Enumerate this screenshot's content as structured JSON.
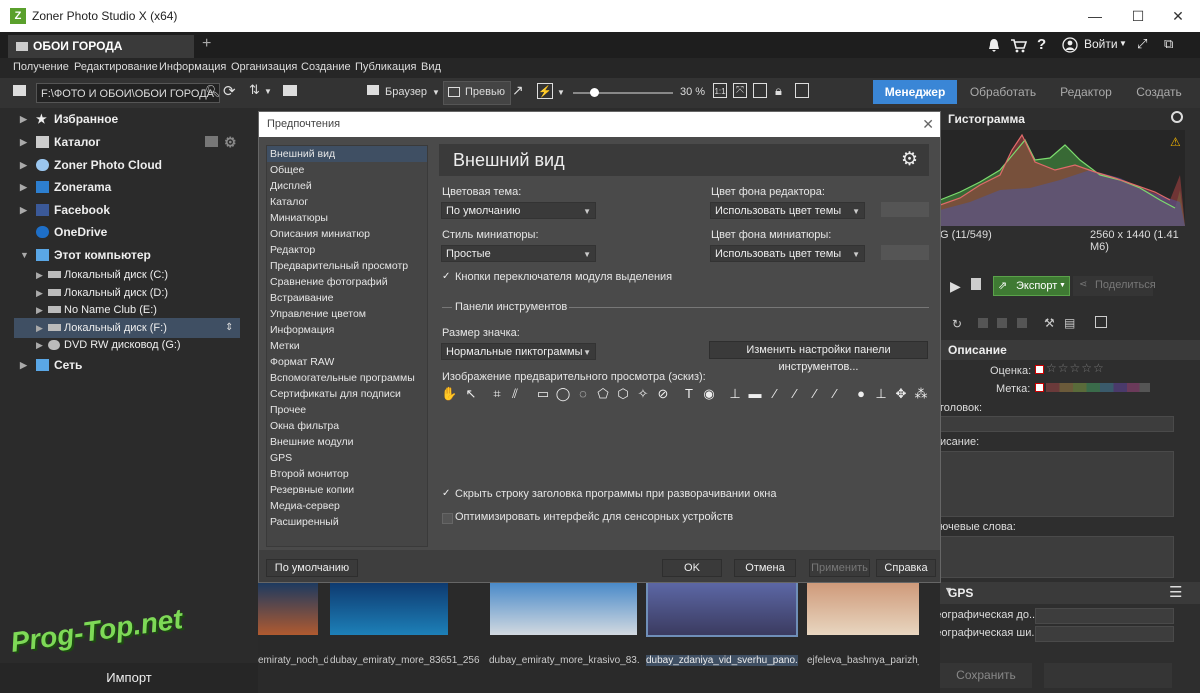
{
  "window": {
    "title": "Zoner Photo Studio X (x64)",
    "minimize": "—",
    "maximize": "☐",
    "close": "✕"
  },
  "tab": {
    "name": "ОБОИ ГОРОДА",
    "add": "+"
  },
  "header_right": {
    "login": "Войти"
  },
  "menu": [
    "Получение",
    "Редактирование",
    "Информация",
    "Организация",
    "Создание",
    "Публикация",
    "Вид"
  ],
  "toolbar": {
    "path": "F:\\ФОТО И ОБОИ\\ОБОИ ГОРОДА",
    "browser": "Браузер",
    "preview": "Превью",
    "zoom": "30 %"
  },
  "modes": {
    "manager": "Менеджер",
    "process": "Обработать",
    "editor": "Редактор",
    "create": "Создать"
  },
  "nav": {
    "favorites": "Избранное",
    "catalog": "Каталог",
    "zoner_cloud": "Zoner Photo Cloud",
    "zonerama": "Zonerama",
    "facebook": "Facebook",
    "onedrive": "OneDrive",
    "this_pc": "Этот компьютер",
    "drives": [
      "Локальный диск (C:)",
      "Локальный диск (D:)",
      "No Name Club (E:)",
      "Локальный диск (F:)",
      "DVD RW дисковод (G:)"
    ],
    "network": "Сеть",
    "import": "Импорт"
  },
  "right": {
    "histogram": "Гистограмма",
    "counter": "G  (11/549)",
    "resolution": "2560 x 1440 (1.41 M6)",
    "export": "Экспорт",
    "share": "Поделиться",
    "description": "Описание",
    "rating": "Оценка:",
    "label": "Метка:",
    "title_field": "головок:",
    "desc_field": "исание:",
    "keywords": "ючевые слова:",
    "gps": "GPS",
    "geo_lat": "Географическая до...",
    "geo_lon": "Географическая ши...",
    "save": "Сохранить"
  },
  "dialog": {
    "title": "Предпочтения",
    "categories": [
      "Внешний вид",
      "Общее",
      "Дисплей",
      "Каталог",
      "Миниатюры",
      "Описания миниатюр",
      "Редактор",
      "Предварительный просмотр",
      "Сравнение фотографий",
      "Встраивание",
      "Управление цветом",
      "Информация",
      "Метки",
      "Формат RAW",
      "Вспомогательные программы",
      "Сертификаты для подписи",
      "Прочее",
      "Окна фильтра",
      "Внешние модули",
      "GPS",
      "Второй монитор",
      "Резервные копии",
      "Медиа-сервер",
      "Расширенный"
    ],
    "page_title": "Внешний вид",
    "color_theme_label": "Цветовая тема:",
    "color_theme_value": "По умолчанию",
    "editor_bg_label": "Цвет фона редактора:",
    "editor_bg_value": "Использовать цвет темы",
    "thumb_style_label": "Стиль миниатюры:",
    "thumb_style_value": "Простые",
    "thumb_bg_label": "Цвет фона миниатюры:",
    "thumb_bg_value": "Использовать цвет темы",
    "module_switch_buttons": "Кнопки переключателя модуля выделения",
    "toolbars_section": "Панели инструментов",
    "icon_size_label": "Размер значка:",
    "icon_size_value": "Нормальные пиктограммы",
    "toolbar_settings_btn": "Изменить настройки панели инструментов...",
    "preview_image_label": "Изображение предварительного просмотра (эскиз):",
    "hide_title_bar": "Скрыть строку заголовка программы при разворачивании окна",
    "touch_optimize": "Оптимизировать интерфейс для сенсорных устройств",
    "btn_default": "По умолчанию",
    "btn_ok": "OK",
    "btn_cancel": "Отмена",
    "btn_apply": "Применить",
    "btn_help": "Справка"
  },
  "thumbnails": [
    "emiraty_noch_d...",
    "dubay_emiraty_more_83651_256...",
    "dubay_emiraty_more_krasivo_83...",
    "dubay_zdaniya_vid_sverhu_pano...",
    "ejfeleva_bashnya_parizh_ze"
  ],
  "watermark": "Prog-Top.net"
}
